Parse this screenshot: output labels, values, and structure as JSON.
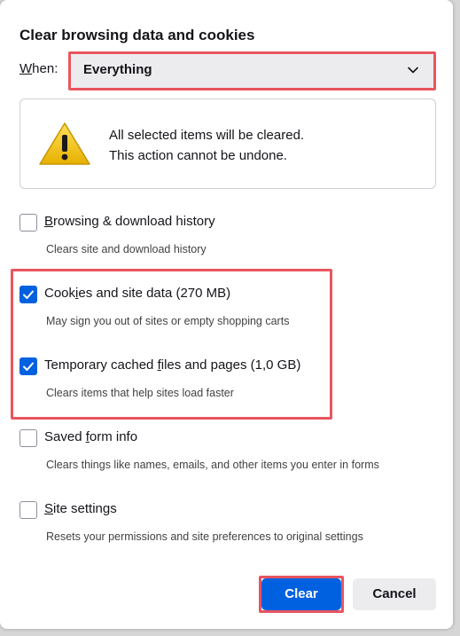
{
  "dialog": {
    "title": "Clear browsing data and cookies",
    "when": {
      "label_first": "W",
      "label_rest": "hen:",
      "selected": "Everything"
    },
    "warning": {
      "line1": "All selected items will be cleared.",
      "line2": "This action cannot be undone."
    },
    "options": [
      {
        "pre": "",
        "access": "B",
        "post": "rowsing & download history",
        "description": "Clears site and download history",
        "checked": false
      },
      {
        "pre": "Cook",
        "access": "i",
        "post": "es and site data (270 MB)",
        "description": "May sign you out of sites or empty shopping carts",
        "checked": true
      },
      {
        "pre": "Temporary cached ",
        "access": "f",
        "post": "iles and pages (1,0 GB)",
        "description": "Clears items that help sites load faster",
        "checked": true
      },
      {
        "pre": "Saved ",
        "access": "f",
        "post": "orm info",
        "description": "Clears things like names, emails, and other items you enter in forms",
        "checked": false
      },
      {
        "pre": "",
        "access": "S",
        "post": "ite settings",
        "description": "Resets your permissions and site preferences to original settings",
        "checked": false
      }
    ],
    "buttons": {
      "clear": "Clear",
      "cancel": "Cancel"
    }
  },
  "colors": {
    "accent": "#0061e0",
    "highlight": "#e8555f",
    "warning": "#f5c400"
  },
  "icons": {
    "warning": "warning-triangle-icon",
    "chevron": "chevron-down-icon",
    "check": "checkmark-icon"
  }
}
